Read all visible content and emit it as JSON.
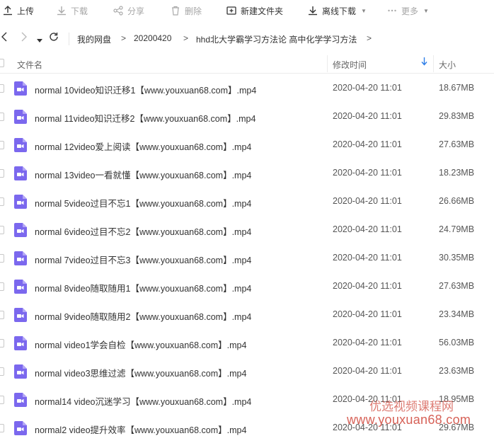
{
  "toolbar": {
    "upload_label": "上传",
    "download_label": "下载",
    "share_label": "分享",
    "delete_label": "删除",
    "new_folder_label": "新建文件夹",
    "offline_download_label": "离线下载",
    "more_label": "更多"
  },
  "breadcrumb": {
    "items": [
      "我的网盘",
      "20200420",
      "hhd北大学霸学习方法论 高中化学学习方法"
    ],
    "separator": ">"
  },
  "columns": {
    "name": "文件名",
    "modified": "修改时间",
    "size": "大小"
  },
  "files": [
    {
      "name": "normal  10video知识迁移1【www.youxuan68.com】.mp4",
      "modified": "2020-04-20 11:01",
      "size": "18.67MB"
    },
    {
      "name": "normal 11video知识迁移2【www.youxuan68.com】.mp4",
      "modified": "2020-04-20 11:01",
      "size": "29.83MB"
    },
    {
      "name": "normal 12video爱上阅读【www.youxuan68.com】.mp4",
      "modified": "2020-04-20 11:01",
      "size": "27.63MB"
    },
    {
      "name": "normal 13video一看就懂【www.youxuan68.com】.mp4",
      "modified": "2020-04-20 11:01",
      "size": "18.23MB"
    },
    {
      "name": "normal 5video过目不忘1【www.youxuan68.com】.mp4",
      "modified": "2020-04-20 11:01",
      "size": "26.66MB"
    },
    {
      "name": "normal 6video过目不忘2【www.youxuan68.com】.mp4",
      "modified": "2020-04-20 11:01",
      "size": "24.79MB"
    },
    {
      "name": "normal 7video过目不忘3【www.youxuan68.com】.mp4",
      "modified": "2020-04-20 11:01",
      "size": "30.35MB"
    },
    {
      "name": "normal 8video随取随用1【www.youxuan68.com】.mp4",
      "modified": "2020-04-20 11:01",
      "size": "27.63MB"
    },
    {
      "name": "normal 9video随取随用2【www.youxuan68.com】.mp4",
      "modified": "2020-04-20 11:01",
      "size": "23.34MB"
    },
    {
      "name": "normal video1学会自检【www.youxuan68.com】.mp4",
      "modified": "2020-04-20 11:01",
      "size": "56.03MB"
    },
    {
      "name": "normal video3思维过滤【www.youxuan68.com】.mp4",
      "modified": "2020-04-20 11:01",
      "size": "23.63MB"
    },
    {
      "name": "normal14 video沉迷学习【www.youxuan68.com】.mp4",
      "modified": "2020-04-20 11:01",
      "size": "18.95MB"
    },
    {
      "name": "normal2 video提升效率【www.youxuan68.com】.mp4",
      "modified": "2020-04-20 11:01",
      "size": "29.67MB"
    }
  ],
  "watermark": {
    "line1": "优选视频课程网",
    "line2": "www.youxuan68.com"
  },
  "colors": {
    "video_icon": "#7b68ee",
    "sort_arrow": "#2f7fe8",
    "watermark": "#d0463a"
  }
}
